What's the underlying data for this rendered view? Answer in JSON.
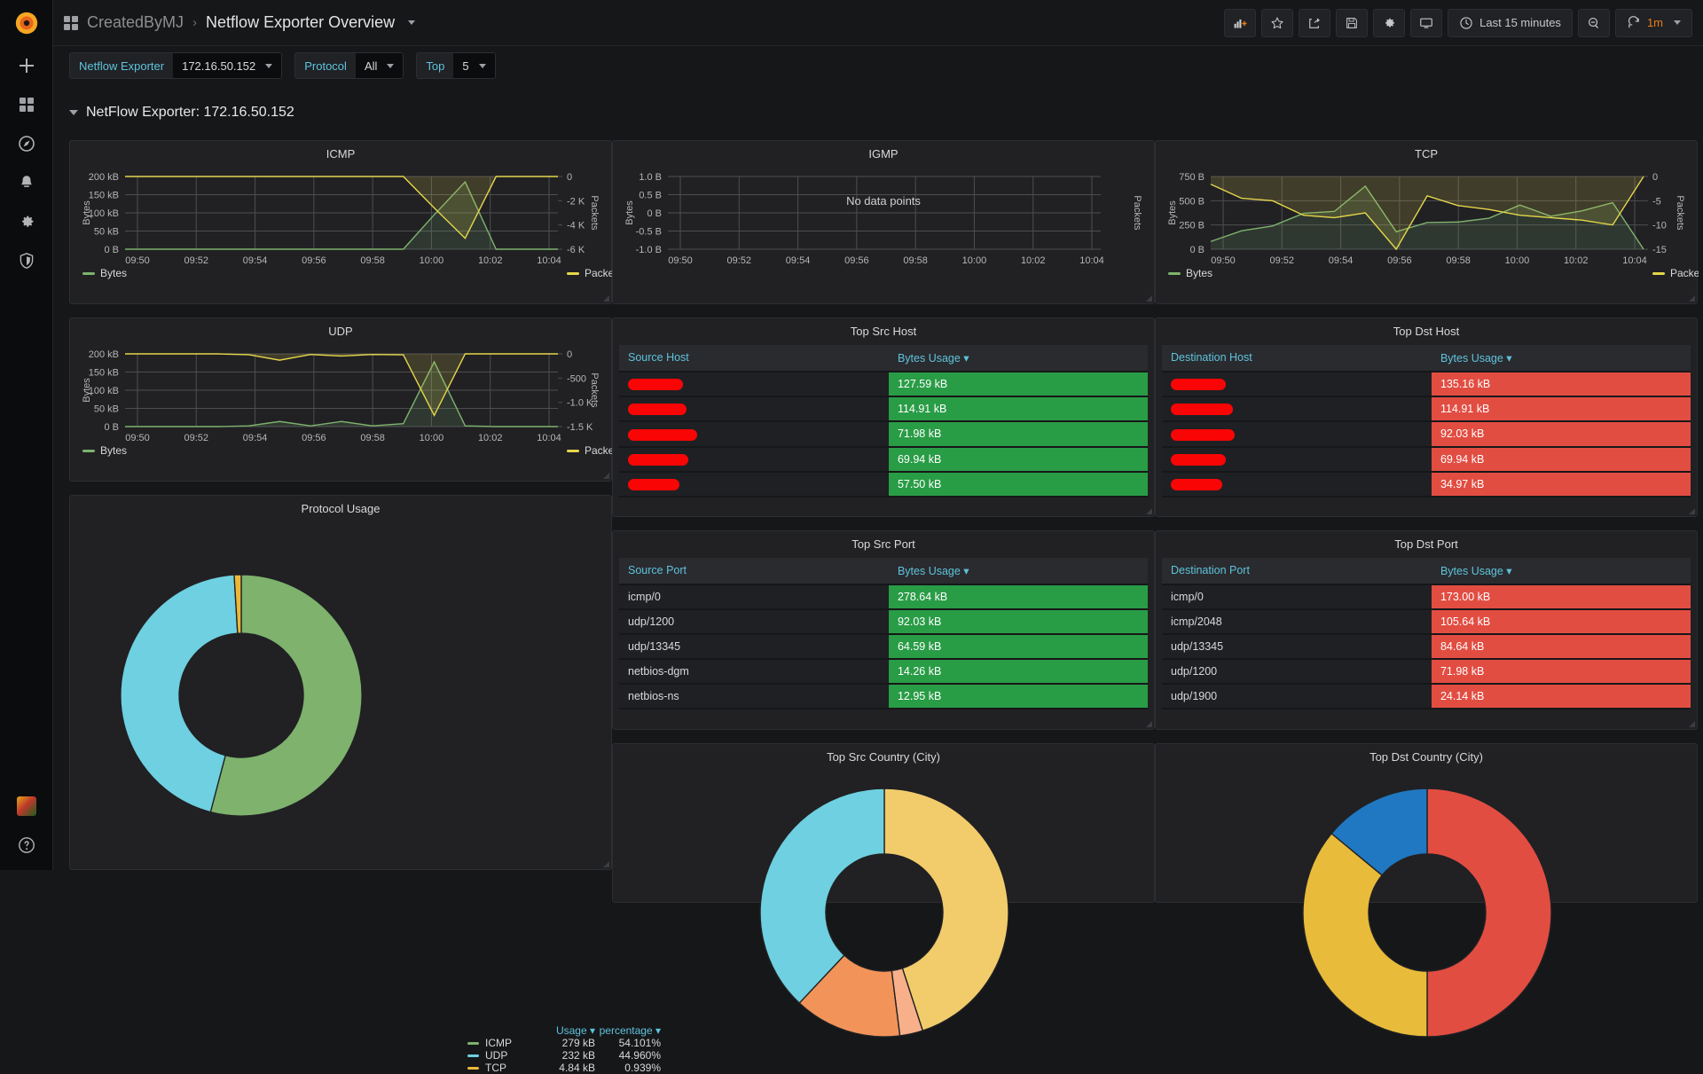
{
  "brand": {
    "logo": "grafana-logo",
    "org_badge": "org-avatar"
  },
  "sidebar": {
    "items": [
      {
        "name": "create-add",
        "icon": "plus-icon",
        "label": "Create"
      },
      {
        "name": "dashboards",
        "icon": "grid-icon",
        "label": "Dashboards"
      },
      {
        "name": "explore",
        "icon": "compass-icon",
        "label": "Explore"
      },
      {
        "name": "alerting",
        "icon": "bell-icon",
        "label": "Alerting"
      },
      {
        "name": "configuration",
        "icon": "gear-icon",
        "label": "Configuration"
      },
      {
        "name": "server-admin",
        "icon": "shield-icon",
        "label": "Server Admin"
      }
    ],
    "help": {
      "icon": "question-circle-icon",
      "label": "Help"
    }
  },
  "topnav": {
    "folder": "CreatedByMJ",
    "separator": "›",
    "title": "Netflow Exporter Overview",
    "actions": [
      {
        "name": "add-panel-button",
        "icon": "add-panel-icon",
        "tooltip": "Add panel"
      },
      {
        "name": "mark-favorite-button",
        "icon": "star-icon",
        "tooltip": "Mark as favorite"
      },
      {
        "name": "share-dashboard-button",
        "icon": "share-icon",
        "tooltip": "Share dashboard"
      },
      {
        "name": "save-dashboard-button",
        "icon": "save-icon",
        "tooltip": "Save dashboard"
      },
      {
        "name": "dashboard-settings-button",
        "icon": "gear-icon",
        "tooltip": "Dashboard settings"
      },
      {
        "name": "cycle-view-mode-button",
        "icon": "monitor-icon",
        "tooltip": "Cycle view mode"
      }
    ],
    "time_range": "Last 15 minutes",
    "time_icon": "clock-icon",
    "zoom_out_icon": "search-minus-icon",
    "refresh_icon": "refresh-icon",
    "refresh_interval": "1m"
  },
  "variables": [
    {
      "label": "Netflow Exporter",
      "value": "172.16.50.152"
    },
    {
      "label": "Protocol",
      "value": "All"
    },
    {
      "label": "Top",
      "value": "5"
    }
  ],
  "row": {
    "title": "NetFlow Exporter: 172.16.50.152",
    "collapsed": false
  },
  "colors": {
    "bytes_green": "#7eb26d",
    "packets_yellow": "#e5d64a",
    "table_green": "#299c46",
    "table_red": "#e24d42",
    "link_blue": "#5ec3dc",
    "accent_orange": "#eb7b18",
    "donut_icmp": "#7eb26d",
    "donut_udp": "#6ed0e0",
    "donut_tcp": "#eab839",
    "country_blue_light": "#6ed0e0",
    "country_orange": "#f2945a",
    "country_peach": "#f7b08a",
    "country_yellow": "#f2cc6b",
    "country_gold": "#e8bb3a",
    "country_blue": "#1f78c1",
    "country_red": "#e24d42"
  },
  "panels": {
    "icmp": {
      "title": "ICMP",
      "legend": [
        {
          "label": "Bytes",
          "color": "#7eb26d"
        },
        {
          "label": "Packe",
          "color": "#e5d64a"
        }
      ]
    },
    "igmp": {
      "title": "IGMP",
      "message": "No data points"
    },
    "tcp": {
      "title": "TCP",
      "legend": [
        {
          "label": "Bytes",
          "color": "#7eb26d"
        },
        {
          "label": "Packe",
          "color": "#e5d64a"
        }
      ]
    },
    "udp": {
      "title": "UDP",
      "legend": [
        {
          "label": "Bytes",
          "color": "#7eb26d"
        },
        {
          "label": "Packe",
          "color": "#e5d64a"
        }
      ]
    },
    "protocol_usage": {
      "title": "Protocol Usage"
    },
    "top_src_host": {
      "title": "Top Src Host",
      "columns": [
        "Source Host",
        "Bytes Usage"
      ],
      "sort_col": 1,
      "rows": [
        {
          "name": "",
          "redacted": true,
          "redact_w": 62,
          "value": "127.59 kB",
          "bar": 100
        },
        {
          "name": "",
          "redacted": true,
          "redact_w": 66,
          "value": "114.91 kB",
          "bar": 100
        },
        {
          "name": "",
          "redacted": true,
          "redact_w": 78,
          "value": "71.98 kB",
          "bar": 100
        },
        {
          "name": "",
          "redacted": true,
          "redact_w": 68,
          "value": "69.94 kB",
          "bar": 100
        },
        {
          "name": "",
          "redacted": true,
          "redact_w": 58,
          "value": "57.50 kB",
          "bar": 100
        }
      ]
    },
    "top_dst_host": {
      "title": "Top Dst Host",
      "columns": [
        "Destination Host",
        "Bytes Usage"
      ],
      "sort_col": 1,
      "rows": [
        {
          "name": "",
          "redacted": true,
          "redact_w": 62,
          "value": "135.16 kB",
          "bar": 100
        },
        {
          "name": "",
          "redacted": true,
          "redact_w": 70,
          "value": "114.91 kB",
          "bar": 100
        },
        {
          "name": "",
          "redacted": true,
          "redact_w": 72,
          "value": "92.03 kB",
          "bar": 100
        },
        {
          "name": "",
          "redacted": true,
          "redact_w": 62,
          "value": "69.94 kB",
          "bar": 100
        },
        {
          "name": "",
          "redacted": true,
          "redact_w": 58,
          "value": "34.97 kB",
          "bar": 100
        }
      ]
    },
    "top_src_port": {
      "title": "Top Src Port",
      "columns": [
        "Source Port",
        "Bytes Usage"
      ],
      "sort_col": 1,
      "rows": [
        {
          "name": "icmp/0",
          "value": "278.64 kB",
          "bar": 100
        },
        {
          "name": "udp/1200",
          "value": "92.03 kB",
          "bar": 100
        },
        {
          "name": "udp/13345",
          "value": "64.59 kB",
          "bar": 100
        },
        {
          "name": "netbios-dgm",
          "value": "14.26 kB",
          "bar": 100
        },
        {
          "name": "netbios-ns",
          "value": "12.95 kB",
          "bar": 100
        }
      ]
    },
    "top_dst_port": {
      "title": "Top Dst Port",
      "columns": [
        "Destination Port",
        "Bytes Usage"
      ],
      "sort_col": 1,
      "rows": [
        {
          "name": "icmp/0",
          "value": "173.00 kB",
          "bar": 100
        },
        {
          "name": "icmp/2048",
          "value": "105.64 kB",
          "bar": 100
        },
        {
          "name": "udp/13345",
          "value": "84.64 kB",
          "bar": 100
        },
        {
          "name": "udp/1200",
          "value": "71.98 kB",
          "bar": 100
        },
        {
          "name": "udp/1900",
          "value": "24.14 kB",
          "bar": 100
        }
      ]
    },
    "top_src_country": {
      "title": "Top Src Country (City)"
    },
    "top_dst_country": {
      "title": "Top Dst Country (City)"
    }
  },
  "chart_data": [
    {
      "type": "line",
      "title": "ICMP",
      "xlabel": "",
      "ylabel": "Bytes",
      "y2label": "Packets",
      "x": [
        "09:50",
        "09:51",
        "09:52",
        "09:53",
        "09:54",
        "09:55",
        "09:56",
        "09:57",
        "09:58",
        "09:59",
        "10:00",
        "10:01",
        "10:02",
        "10:03",
        "10:04"
      ],
      "xticks": [
        "09:50",
        "09:52",
        "09:54",
        "09:56",
        "09:58",
        "10:00",
        "10:02",
        "10:04"
      ],
      "yticks": [
        "0 B",
        "50 kB",
        "100 kB",
        "150 kB",
        "200 kB"
      ],
      "ylim": [
        0,
        200000
      ],
      "y2ticks": [
        "-6 K",
        "-4 K",
        "-2 K",
        "0"
      ],
      "y2lim": [
        -6000,
        0
      ],
      "grid": true,
      "series": [
        {
          "name": "Bytes",
          "color": "#7eb26d",
          "axis": "left",
          "values": [
            0,
            0,
            0,
            0,
            0,
            0,
            0,
            0,
            0,
            0,
            95000,
            185000,
            0,
            0,
            0
          ]
        },
        {
          "name": "Packets",
          "color": "#e5d64a",
          "axis": "right",
          "values": [
            0,
            0,
            0,
            0,
            0,
            0,
            0,
            0,
            0,
            0,
            -2600,
            -5100,
            0,
            0,
            0
          ]
        }
      ]
    },
    {
      "type": "line",
      "title": "IGMP",
      "ylabel": "Bytes",
      "y2label": "Packets",
      "message": "No data points",
      "xticks": [
        "09:50",
        "09:52",
        "09:54",
        "09:56",
        "09:58",
        "10:00",
        "10:02",
        "10:04"
      ],
      "yticks": [
        "-1.0 B",
        "-0.5 B",
        "0 B",
        "0.5 B",
        "1.0 B"
      ],
      "ylim": [
        -1,
        1
      ],
      "grid": true,
      "series": []
    },
    {
      "type": "line",
      "title": "TCP",
      "ylabel": "Bytes",
      "y2label": "Packets",
      "x": [
        "09:50",
        "09:51",
        "09:52",
        "09:53",
        "09:54",
        "09:55",
        "09:56",
        "09:57",
        "09:58",
        "09:59",
        "10:00",
        "10:01",
        "10:02",
        "10:03",
        "10:04"
      ],
      "xticks": [
        "09:50",
        "09:52",
        "09:54",
        "09:56",
        "09:58",
        "10:00",
        "10:02",
        "10:04"
      ],
      "yticks": [
        "0 B",
        "250 B",
        "500 B",
        "750 B"
      ],
      "ylim": [
        0,
        750
      ],
      "y2ticks": [
        "-15",
        "-10",
        "-5",
        "0"
      ],
      "y2lim": [
        -15,
        0
      ],
      "grid": true,
      "series": [
        {
          "name": "Bytes",
          "color": "#7eb26d",
          "axis": "left",
          "values": [
            80,
            190,
            240,
            370,
            390,
            650,
            180,
            275,
            280,
            320,
            455,
            340,
            395,
            480,
            0
          ]
        },
        {
          "name": "Packets",
          "color": "#e5d64a",
          "axis": "right",
          "values": [
            -1.6,
            -4.5,
            -5,
            -8,
            -8.5,
            -7.5,
            -15,
            -4,
            -6,
            -6.8,
            -8,
            -8.5,
            -9,
            -10,
            0
          ]
        }
      ]
    },
    {
      "type": "line",
      "title": "UDP",
      "ylabel": "Bytes",
      "y2label": "Packets",
      "x": [
        "09:50",
        "09:51",
        "09:52",
        "09:53",
        "09:54",
        "09:55",
        "09:56",
        "09:57",
        "09:58",
        "09:59",
        "10:00",
        "10:01",
        "10:02",
        "10:03",
        "10:04"
      ],
      "xticks": [
        "09:50",
        "09:52",
        "09:54",
        "09:56",
        "09:58",
        "10:00",
        "10:02",
        "10:04"
      ],
      "yticks": [
        "0 B",
        "50 kB",
        "100 kB",
        "150 kB",
        "200 kB"
      ],
      "ylim": [
        0,
        200000
      ],
      "y2ticks": [
        "-1.5 K",
        "-1.0 K",
        "-500",
        "0"
      ],
      "y2lim": [
        -1500,
        0
      ],
      "grid": true,
      "series": [
        {
          "name": "Bytes",
          "color": "#7eb26d",
          "axis": "left",
          "values": [
            0,
            0,
            0,
            0,
            2000,
            14000,
            2000,
            14000,
            2000,
            8000,
            178000,
            2000,
            0,
            0,
            0
          ]
        },
        {
          "name": "Packets",
          "color": "#e5d64a",
          "axis": "right",
          "values": [
            0,
            0,
            0,
            0,
            -18,
            -130,
            -12,
            -45,
            -12,
            -20,
            -1270,
            0,
            0,
            0,
            0
          ]
        }
      ]
    },
    {
      "type": "pie",
      "title": "Protocol Usage",
      "legend_columns": [
        "Usage",
        "percentage"
      ],
      "labels": [
        "ICMP",
        "UDP",
        "TCP"
      ],
      "values": [
        279000,
        232000,
        4840
      ],
      "display_values": [
        "279 kB",
        "232 kB",
        "4.84 kB"
      ],
      "percentages": [
        "54.101%",
        "44.960%",
        "0.939%"
      ],
      "percent_numeric": [
        54.101,
        44.96,
        0.939
      ],
      "colors": [
        "#7eb26d",
        "#6ed0e0",
        "#eab839"
      ],
      "legend_position": "right",
      "donut": true
    },
    {
      "type": "pie",
      "title": "Top Src Country (City)",
      "colors": [
        "#f2cc6b",
        "#f7b08a",
        "#f2945a",
        "#6ed0e0"
      ],
      "percent_numeric": [
        45,
        3,
        14,
        38
      ],
      "donut": true
    },
    {
      "type": "pie",
      "title": "Top Dst Country (City)",
      "colors": [
        "#e24d42",
        "#e8bb3a",
        "#1f78c1"
      ],
      "percent_numeric": [
        50,
        36,
        14
      ],
      "donut": true
    }
  ]
}
